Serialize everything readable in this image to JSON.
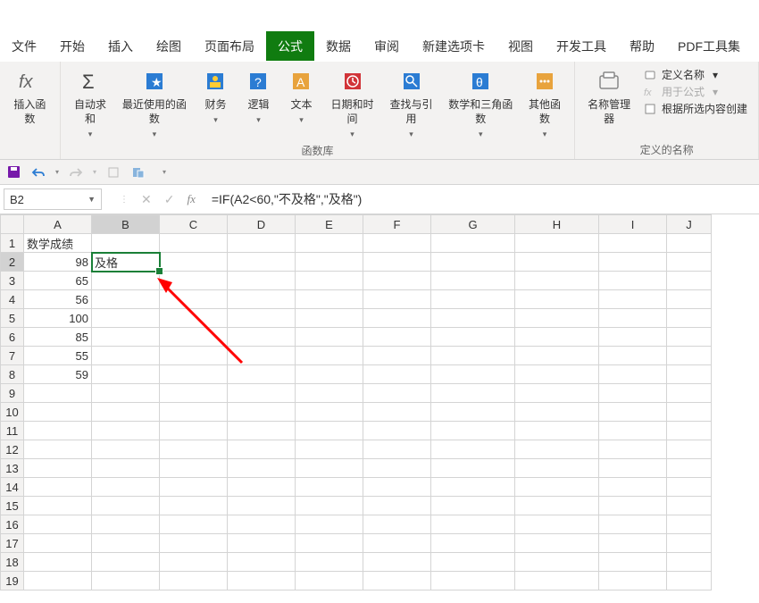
{
  "tabs": [
    "文件",
    "开始",
    "插入",
    "绘图",
    "页面布局",
    "公式",
    "数据",
    "审阅",
    "新建选项卡",
    "视图",
    "开发工具",
    "帮助",
    "PDF工具集"
  ],
  "activeTab": "公式",
  "ribbon": {
    "insertFunction": "插入函数",
    "autoSum": "自动求和",
    "recent": "最近使用的函数",
    "financial": "财务",
    "logical": "逻辑",
    "text": "文本",
    "dateTime": "日期和时间",
    "lookup": "查找与引用",
    "mathTrig": "数学和三角函数",
    "more": "其他函数",
    "libLabel": "函数库",
    "nameMgr": "名称管理器",
    "defineName": "定义名称",
    "useInFormula": "用于公式",
    "createFromSel": "根据所选内容创建",
    "definedNames": "定义的名称"
  },
  "nameBox": "B2",
  "formula": "=IF(A2<60,\"不及格\",\"及格\")",
  "columns": [
    "A",
    "B",
    "C",
    "D",
    "E",
    "F",
    "G",
    "H",
    "I",
    "J"
  ],
  "rows": [
    "1",
    "2",
    "3",
    "4",
    "5",
    "6",
    "7",
    "8",
    "9",
    "10",
    "11",
    "12",
    "13",
    "14",
    "15",
    "16",
    "17",
    "18",
    "19"
  ],
  "cells": {
    "A1": "数学成绩",
    "A2": "98",
    "A3": "65",
    "A4": "56",
    "A5": "100",
    "A6": "85",
    "A7": "55",
    "A8": "59",
    "B2": "及格"
  },
  "selected": "B2"
}
